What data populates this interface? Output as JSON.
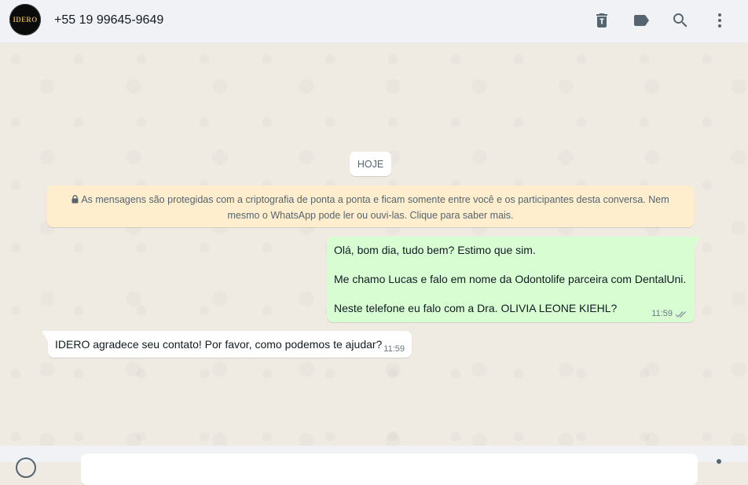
{
  "header": {
    "avatar_text": "IDERO",
    "contact_name": "+55 19 99645-9649",
    "icons": [
      "delete-icon",
      "label-icon",
      "search-icon",
      "menu-icon"
    ]
  },
  "chat": {
    "day_label": "HOJE",
    "encryption_notice": "As mensagens são protegidas com a criptografia de ponta a ponta e ficam somente entre você e os participantes desta conversa. Nem mesmo o WhatsApp pode ler ou ouvi-las. Clique para saber mais.",
    "messages": [
      {
        "direction": "outgoing",
        "lines": [
          "Olá, bom dia, tudo bem? Estimo que sim.",
          "Me chamo Lucas e falo em nome da Odontolife parceira com DentalUni.",
          "Neste telefone eu falo com a Dra. OLIVIA LEONE KIEHL?"
        ],
        "time": "11:59",
        "status": "read"
      },
      {
        "direction": "incoming",
        "text": "IDERO agradece seu contato! Por favor, como podemos te ajudar?",
        "time": "11:59"
      }
    ]
  },
  "colors": {
    "header_bg": "#f0f2f5",
    "chat_bg": "#efeae2",
    "outgoing_bubble": "#d9fdd3",
    "incoming_bubble": "#ffffff",
    "encryption_bg": "#ffeecd",
    "icon": "#54656f",
    "read_ticks": "#8696a0"
  }
}
